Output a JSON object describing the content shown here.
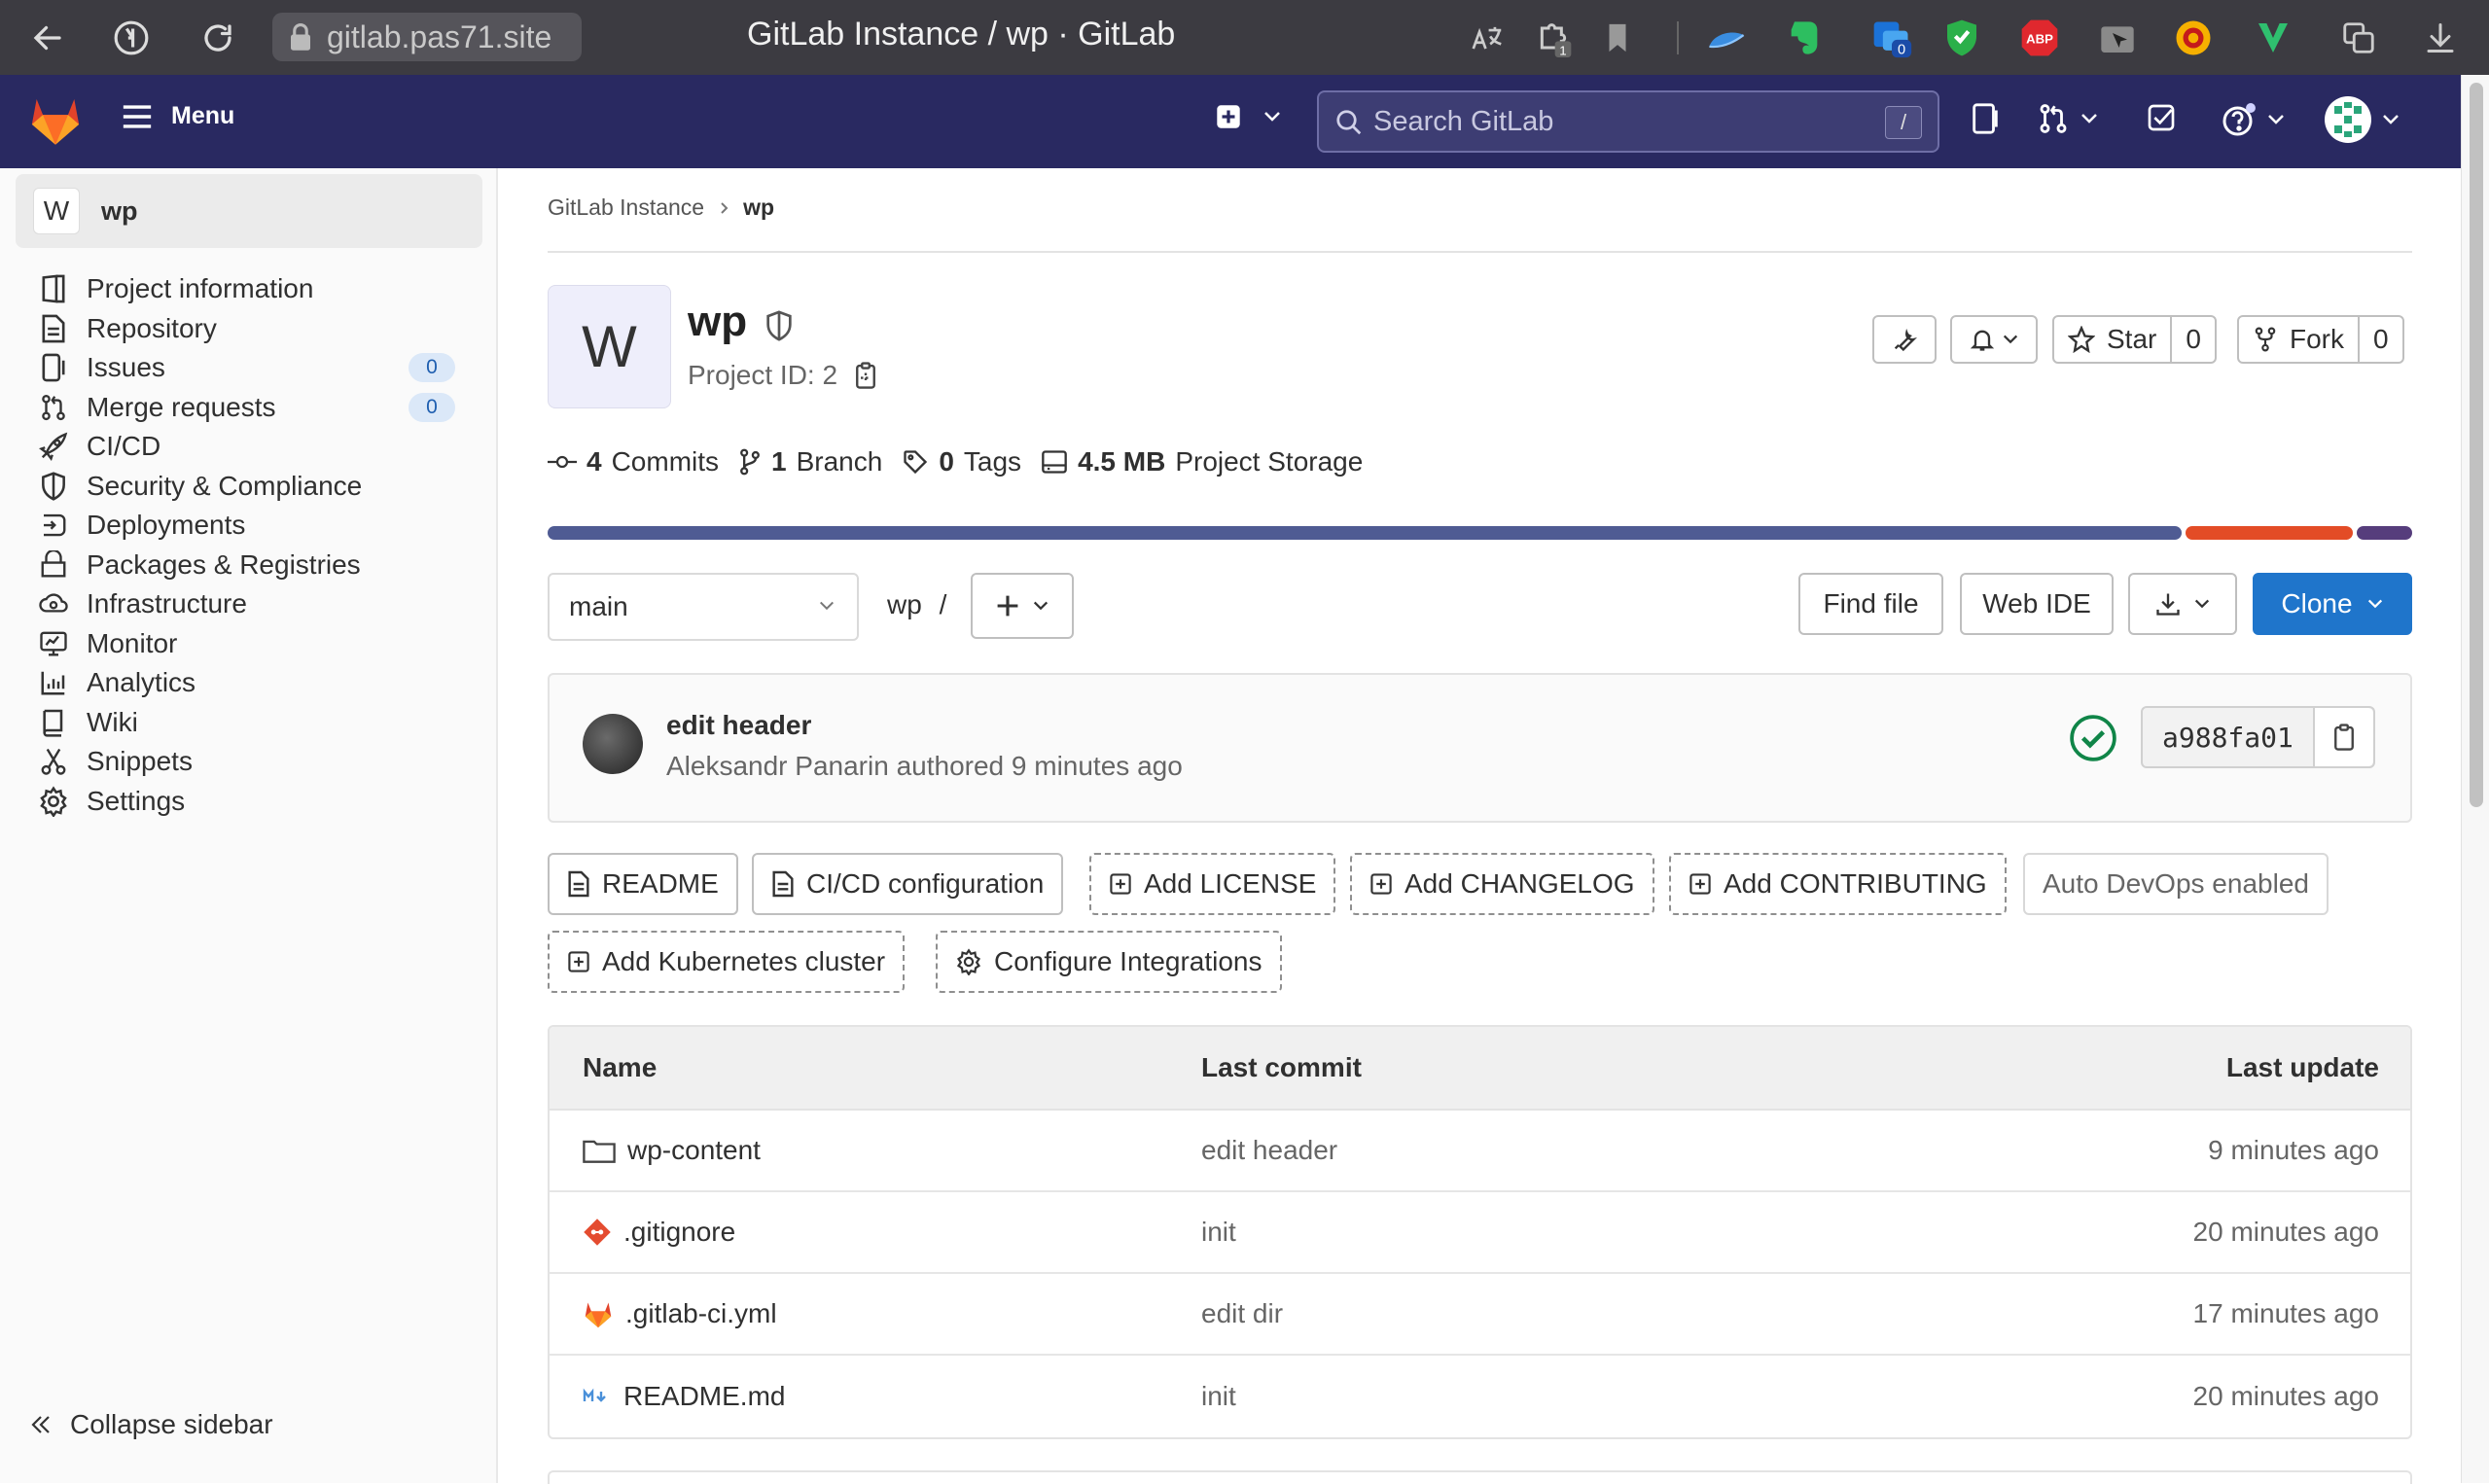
{
  "browser": {
    "url": "gitlab.pas71.site",
    "title": "GitLab Instance / wp · GitLab",
    "extensions": [
      "translate-icon",
      "puzzle-icon",
      "bookmark-icon",
      "cloud-icon",
      "evernote-icon",
      "outlook-icon",
      "shield-check-icon",
      "adblock-icon",
      "cursor-icon",
      "vpn-icon",
      "v-icon",
      "copy-icon",
      "download-icon"
    ],
    "puzzle_badge": "1",
    "outlook_badge": "0",
    "abp_label": "ABP"
  },
  "header": {
    "menu_label": "Menu",
    "search_placeholder": "Search GitLab",
    "search_shortcut": "/"
  },
  "sidebar": {
    "project_avatar": "W",
    "project_name": "wp",
    "items": [
      {
        "label": "Project information",
        "icon": "project-icon"
      },
      {
        "label": "Repository",
        "icon": "doc-icon"
      },
      {
        "label": "Issues",
        "icon": "issues-icon",
        "badge": "0"
      },
      {
        "label": "Merge requests",
        "icon": "merge-request-icon",
        "badge": "0"
      },
      {
        "label": "CI/CD",
        "icon": "rocket-icon"
      },
      {
        "label": "Security & Compliance",
        "icon": "shield-icon"
      },
      {
        "label": "Deployments",
        "icon": "deployments-icon"
      },
      {
        "label": "Packages & Registries",
        "icon": "package-icon"
      },
      {
        "label": "Infrastructure",
        "icon": "cloud-gear-icon"
      },
      {
        "label": "Monitor",
        "icon": "monitor-icon"
      },
      {
        "label": "Analytics",
        "icon": "analytics-icon"
      },
      {
        "label": "Wiki",
        "icon": "book-icon"
      },
      {
        "label": "Snippets",
        "icon": "snippet-icon"
      },
      {
        "label": "Settings",
        "icon": "gear-icon"
      }
    ],
    "collapse_label": "Collapse sidebar"
  },
  "breadcrumb": {
    "group": "GitLab Instance",
    "project": "wp"
  },
  "project": {
    "avatar": "W",
    "name": "wp",
    "id_text": "Project ID: 2",
    "star_label": "Star",
    "star_count": "0",
    "fork_label": "Fork",
    "fork_count": "0"
  },
  "stats": {
    "commits_count": "4",
    "commits_label": "Commits",
    "branches_count": "1",
    "branches_label": "Branch",
    "tags_count": "0",
    "tags_label": "Tags",
    "storage_size": "4.5 MB",
    "storage_label": "Project Storage"
  },
  "languages": [
    {
      "share": 0.88,
      "color": "#4f5b93"
    },
    {
      "share": 0.09,
      "color": "#e34c26"
    },
    {
      "share": 0.03,
      "color": "#563d7c"
    }
  ],
  "repo_controls": {
    "branch": "main",
    "path": "wp",
    "path_sep": "/",
    "find_file": "Find file",
    "web_ide": "Web IDE",
    "clone": "Clone"
  },
  "last_commit": {
    "title": "edit header",
    "author_meta": "Aleksandr Panarin authored 9 minutes ago",
    "sha": "a988fa01"
  },
  "quick_actions": {
    "readme": "README",
    "cicd": "CI/CD configuration",
    "license": "Add LICENSE",
    "changelog": "Add CHANGELOG",
    "contributing": "Add CONTRIBUTING",
    "autodevops": "Auto DevOps enabled",
    "kubernetes": "Add Kubernetes cluster",
    "integrations": "Configure Integrations"
  },
  "files": {
    "headers": {
      "name": "Name",
      "last_commit": "Last commit",
      "last_update": "Last update"
    },
    "rows": [
      {
        "name": "wp-content",
        "icon": "folder-icon",
        "commit": "edit header",
        "updated": "9 minutes ago"
      },
      {
        "name": ".gitignore",
        "icon": "git-icon",
        "commit": "init",
        "updated": "20 minutes ago"
      },
      {
        "name": ".gitlab-ci.yml",
        "icon": "gitlab-icon",
        "commit": "edit dir",
        "updated": "17 minutes ago"
      },
      {
        "name": "README.md",
        "icon": "markdown-icon",
        "commit": "init",
        "updated": "20 minutes ago"
      }
    ]
  }
}
